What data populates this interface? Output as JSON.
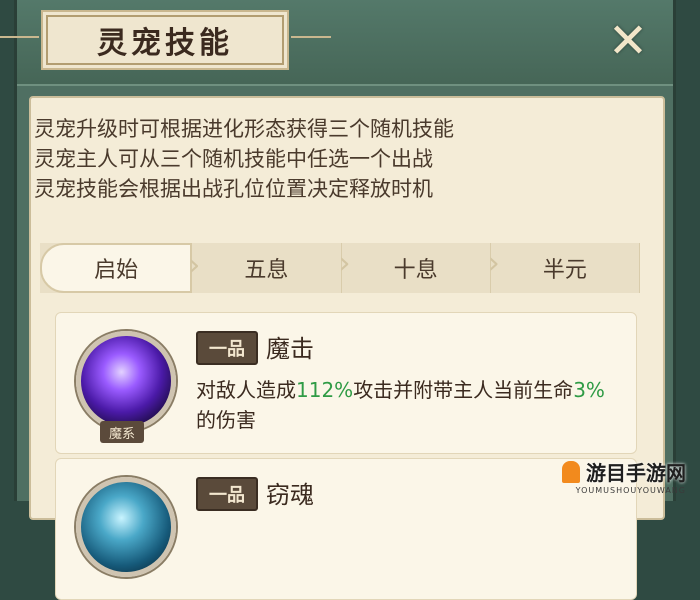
{
  "header": {
    "title": "灵宠技能",
    "close_icon": "close-icon"
  },
  "description": {
    "lines": [
      "灵宠升级时可根据进化形态获得三个随机技能",
      "灵宠主人可从三个随机技能中任选一个出战",
      "灵宠技能会根据出战孔位位置决定释放时机"
    ]
  },
  "tabs": [
    {
      "label": "启始",
      "active": true
    },
    {
      "label": "五息",
      "active": false
    },
    {
      "label": "十息",
      "active": false
    },
    {
      "label": "半元",
      "active": false
    }
  ],
  "skills": [
    {
      "grade": "一品",
      "name": "魔击",
      "element": "魔系",
      "desc_parts": [
        "对敌人造成",
        "112%",
        "攻击并附带主人当前生命",
        "3%",
        "的伤害"
      ]
    },
    {
      "grade": "一品",
      "name": "窃魂"
    }
  ],
  "watermark": {
    "main": "游目手游网",
    "sub": "YOUMUSHOUYOUWANG"
  },
  "colors": {
    "highlight": "#2f9b45",
    "panel_bg": "#f4ecd7",
    "frame": "#4f6f62"
  }
}
